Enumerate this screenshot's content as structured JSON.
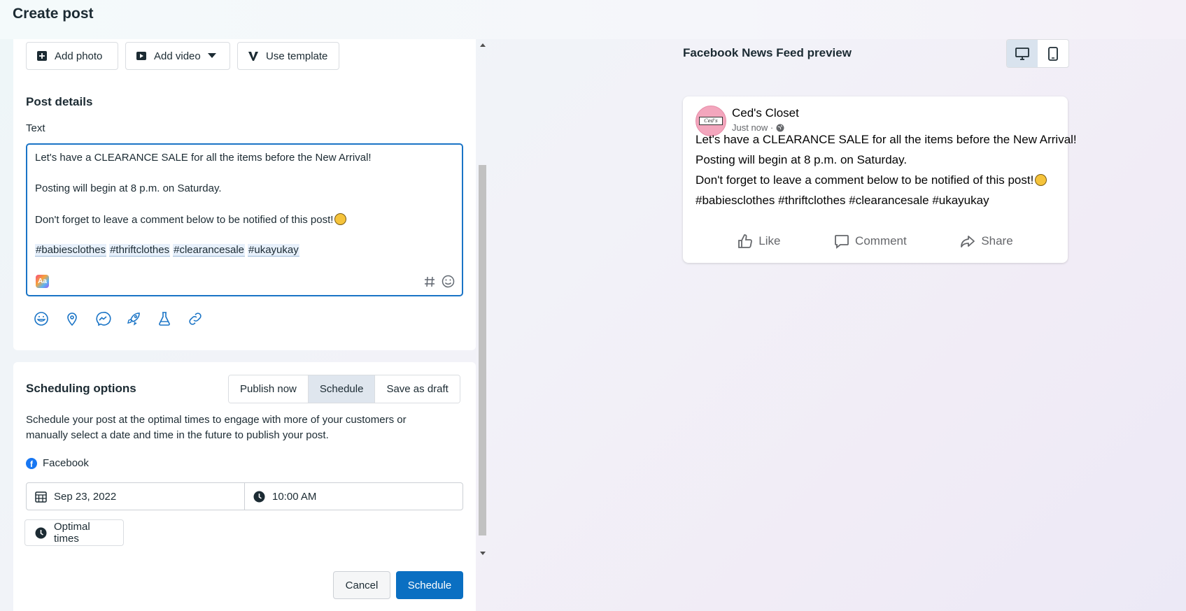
{
  "header": {
    "title": "Create post"
  },
  "media": {
    "add_photo": "Add photo",
    "add_video": "Add video",
    "use_template": "Use template"
  },
  "post_details": {
    "title": "Post details",
    "text_label": "Text",
    "lines": [
      "Let's have a CLEARANCE SALE for all the items before the New Arrival!",
      "Posting will begin at 8 p.m. on Saturday.",
      "Don't forget to leave a comment below to be notified of this post!"
    ],
    "hashtags": [
      "#babiesclothes",
      "#thriftclothes",
      "#clearancesale",
      "#ukayukay"
    ],
    "text_icon": "Aa"
  },
  "scheduling": {
    "title": "Scheduling options",
    "options": [
      "Publish now",
      "Schedule",
      "Save as draft"
    ],
    "selected": "Schedule",
    "description": "Schedule your post at the optimal times to engage with more of your customers or manually select a date and time in the future to publish your post.",
    "platform": "Facebook",
    "date": "Sep 23, 2022",
    "time": "10:00 AM",
    "optimal_times": "Optimal times"
  },
  "footer": {
    "cancel": "Cancel",
    "schedule": "Schedule"
  },
  "preview": {
    "title": "Facebook News Feed preview",
    "page_name": "Ced's Closet",
    "timestamp": "Just now ·",
    "post_lines": [
      "Let's have a CLEARANCE SALE for all the items before the New Arrival!",
      "Posting will begin at 8 p.m. on Saturday.",
      "Don't forget to leave a comment below to be notified of this post!",
      "#babiesclothes #thriftclothes #clearancesale #ukayukay"
    ],
    "like": "Like",
    "comment": "Comment",
    "share": "Share"
  },
  "colors": {
    "primary": "#0a6fc2",
    "focus_border": "#1a74c6",
    "facebook_blue": "#1877f2"
  }
}
